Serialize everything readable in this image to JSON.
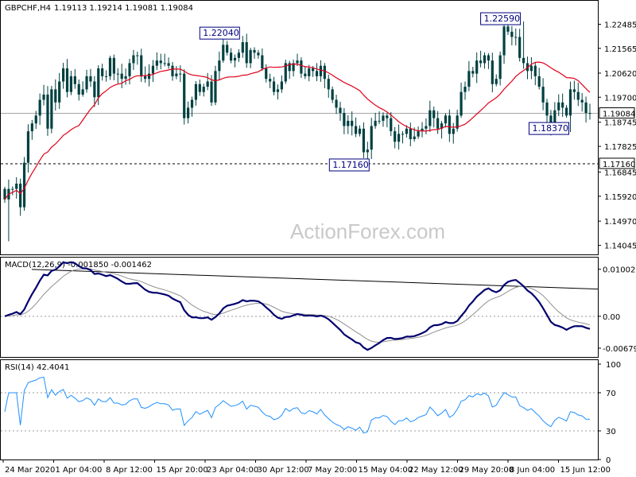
{
  "chart_data": {
    "type": "candlestick",
    "symbol": "GBPCHF,H4",
    "ohlc_header": "1.19113 1.19214 1.19081 1.19084",
    "watermark": "ActionForex.com",
    "x_labels": [
      "24 Mar 2020",
      "1 Apr 04:00",
      "8 Apr 12:00",
      "15 Apr 20:00",
      "23 Apr 04:00",
      "30 Apr 12:00",
      "7 May 20:00",
      "15 May 04:00",
      "22 May 12:00",
      "29 May 20:00",
      "8 Jun 04:00",
      "15 Jun 12:00"
    ],
    "price_panel": {
      "ylim": [
        1.137,
        1.2338
      ],
      "y_ticks": [
        "1.22485",
        "1.21565",
        "1.20620",
        "1.19700",
        "1.18745",
        "1.17825",
        "1.16845",
        "1.15920",
        "1.14970",
        "1.14045"
      ],
      "current_price": "1.19084",
      "support_level": "1.17160",
      "annotations": [
        {
          "label": "1.22040",
          "x": 61,
          "y": 1.2204
        },
        {
          "label": "1.17160",
          "x": 93,
          "y": 1.1716
        },
        {
          "label": "1.22590",
          "x": 133,
          "y": 1.2259
        },
        {
          "label": "1.18370",
          "x": 145,
          "y": 1.1837
        }
      ],
      "moving_average_color": "#e0001a",
      "candle_color": "#004040",
      "closes": [
        1.158,
        1.162,
        1.162,
        1.164,
        1.155,
        1.172,
        1.184,
        1.187,
        1.19,
        1.196,
        1.198,
        1.185,
        1.2,
        1.195,
        1.203,
        1.208,
        1.199,
        1.205,
        1.202,
        1.198,
        1.2,
        1.205,
        1.203,
        1.197,
        1.208,
        1.205,
        1.205,
        1.212,
        1.206,
        1.206,
        1.204,
        1.205,
        1.21,
        1.213,
        1.213,
        1.205,
        1.204,
        1.206,
        1.209,
        1.211,
        1.21,
        1.21,
        1.209,
        1.205,
        1.206,
        1.206,
        1.189,
        1.193,
        1.196,
        1.202,
        1.199,
        1.201,
        1.203,
        1.195,
        1.207,
        1.211,
        1.217,
        1.214,
        1.211,
        1.212,
        1.214,
        1.218,
        1.21,
        1.215,
        1.214,
        1.213,
        1.208,
        1.204,
        1.203,
        1.199,
        1.2,
        1.203,
        1.21,
        1.207,
        1.21,
        1.211,
        1.206,
        1.205,
        1.208,
        1.207,
        1.205,
        1.209,
        1.204,
        1.2,
        1.196,
        1.193,
        1.191,
        1.186,
        1.188,
        1.186,
        1.183,
        1.185,
        1.176,
        1.177,
        1.186,
        1.188,
        1.188,
        1.19,
        1.189,
        1.184,
        1.18,
        1.183,
        1.183,
        1.185,
        1.181,
        1.182,
        1.184,
        1.185,
        1.186,
        1.192,
        1.189,
        1.185,
        1.187,
        1.19,
        1.183,
        1.185,
        1.19,
        1.199,
        1.201,
        1.207,
        1.206,
        1.211,
        1.21,
        1.213,
        1.211,
        1.202,
        1.204,
        1.213,
        1.224,
        1.222,
        1.22,
        1.22,
        1.212,
        1.21,
        1.207,
        1.209,
        1.205,
        1.201,
        1.195,
        1.19,
        1.186,
        1.192,
        1.195,
        1.193,
        1.19,
        1.2,
        1.199,
        1.196,
        1.195,
        1.191,
        1.1908
      ]
    },
    "macd_panel": {
      "label": "MACD(12,26,9) -0.001850 -0.001462",
      "y_ticks": [
        "0.010028",
        "0.00",
        "-0.006797"
      ],
      "ylim": [
        -0.0085,
        0.0115
      ]
    },
    "rsi_panel": {
      "label": "RSI(14) 42.4041",
      "y_ticks": [
        "100",
        "70",
        "30",
        "0"
      ],
      "ylim": [
        0,
        100
      ]
    }
  }
}
